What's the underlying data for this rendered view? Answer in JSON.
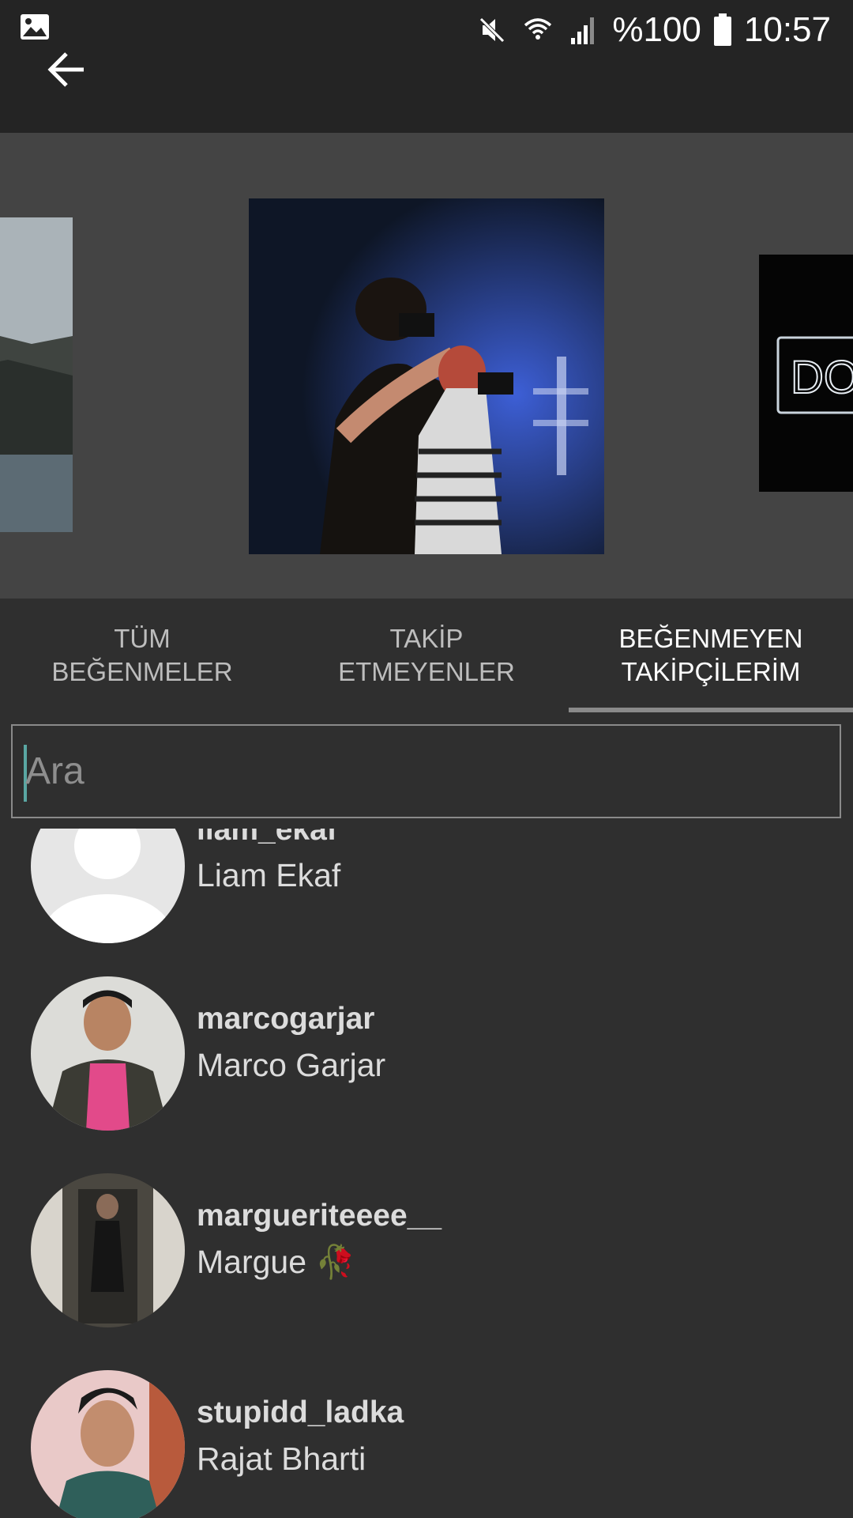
{
  "status_bar": {
    "battery_percent": "%100",
    "time": "10:57",
    "icons": [
      "gallery-icon",
      "mute-icon",
      "wifi-icon",
      "signal-icon",
      "battery-icon"
    ]
  },
  "app_bar": {
    "back_icon": "arrow-left-icon"
  },
  "carousel": {
    "items": [
      "landscape-photo",
      "photographers-concert-photo",
      "neon-sign-photo"
    ]
  },
  "tabs": [
    {
      "label": "TÜM\nBEĞENMELER",
      "active": false
    },
    {
      "label": "TAKİP\nETMEYENLER",
      "active": false
    },
    {
      "label": "BEĞENMEYEN\nTAKİPÇİLERİM",
      "active": true
    }
  ],
  "search": {
    "placeholder": "Ara",
    "value": ""
  },
  "users": [
    {
      "username": "liam_ekaf",
      "full_name": "Liam Ekaf",
      "avatar": "default-avatar"
    },
    {
      "username": "marcogarjar",
      "full_name": "Marco Garjar",
      "avatar": "photo"
    },
    {
      "username": "margueriteeee__",
      "full_name": "Margue 🥀",
      "avatar": "photo"
    },
    {
      "username": "stupidd_ladka",
      "full_name": "Rajat Bharti",
      "avatar": "photo"
    }
  ],
  "colors": {
    "app_bar": "#242424",
    "carousel_bg": "#444444",
    "background": "#2f2f2f",
    "accent_caret": "#5aa7a3",
    "tab_indicator": "#8a8a8a"
  }
}
